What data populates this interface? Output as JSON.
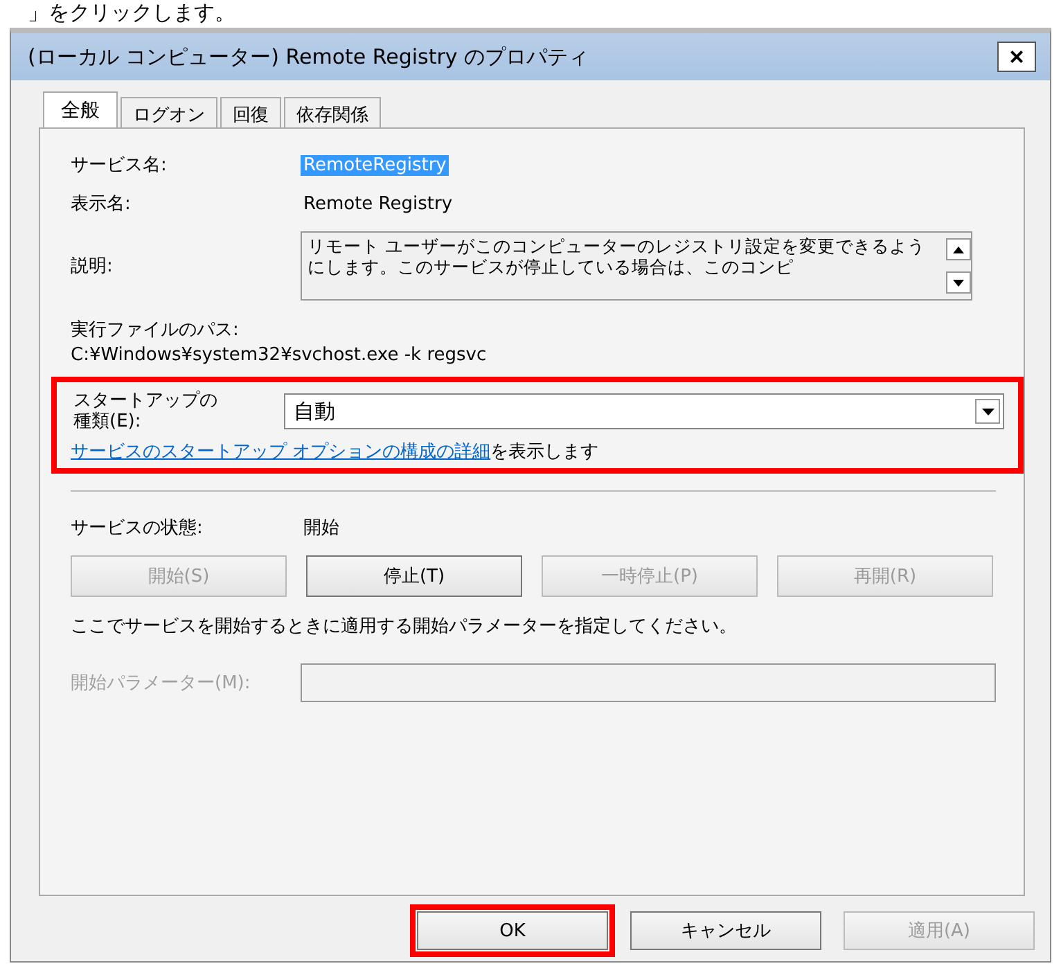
{
  "caption": "」をクリックします。",
  "window": {
    "title": "(ローカル コンピューター) Remote Registry のプロパティ",
    "close": "×"
  },
  "tabs": [
    {
      "label": "全般",
      "selected": true
    },
    {
      "label": "ログオン",
      "selected": false
    },
    {
      "label": "回復",
      "selected": false
    },
    {
      "label": "依存関係",
      "selected": false
    }
  ],
  "service_name": {
    "label": "サービス名:",
    "value": "RemoteRegistry",
    "selected": true
  },
  "display_name": {
    "label": "表示名:",
    "value": "Remote Registry"
  },
  "description": {
    "label": "説明:",
    "value": "リモート ユーザーがこのコンピューターのレジストリ設定を変更できるようにします。このサービスが停止している場合は、このコンピ"
  },
  "path": {
    "label": "実行ファイルのパス:",
    "value": "C:¥Windows¥system32¥svchost.exe -k regsvc"
  },
  "startup_type": {
    "label": "スタートアップの種類(E):",
    "value": "自動",
    "highlighted": true
  },
  "help": {
    "link": "サービスのスタートアップ オプションの構成の詳細",
    "text": "を表示します"
  },
  "status": {
    "label": "サービスの状態:",
    "value": "開始"
  },
  "service_buttons": [
    {
      "label": "開始(S)",
      "disabled": true
    },
    {
      "label": "停止(T)",
      "disabled": false
    },
    {
      "label": "一時停止(P)",
      "disabled": true
    },
    {
      "label": "再開(R)",
      "disabled": true
    }
  ],
  "hint": "ここでサービスを開始するときに適用する開始パラメーターを指定してください。",
  "parameters": {
    "label": "開始パラメーター(M):",
    "disabled": true
  },
  "dialog_buttons": [
    {
      "label": "OK",
      "disabled": false,
      "highlighted": true
    },
    {
      "label": "キャンセル",
      "disabled": false,
      "highlighted": false
    },
    {
      "label": "適用(A)",
      "disabled": true,
      "highlighted": false
    }
  ]
}
